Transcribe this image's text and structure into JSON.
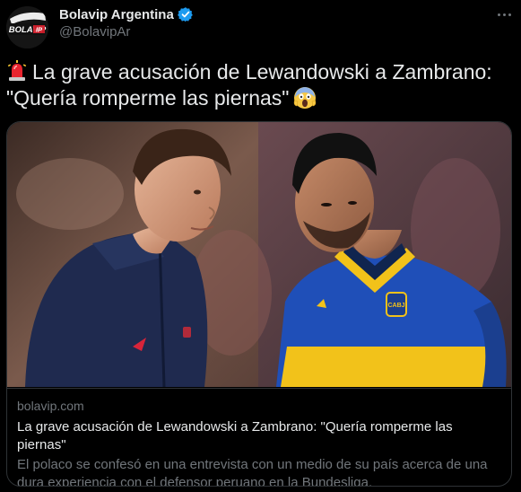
{
  "author": {
    "display_name": "Bolavip Argentina",
    "handle": "@BolavipAr",
    "avatar_text": "BOLAVIP",
    "verified_icon": "verified-badge-icon"
  },
  "tweet": {
    "text": "La grave acusación de Lewandowski a Zambrano: \"Quería romperme las piernas\"",
    "leading_emoji": "police-siren-icon",
    "trailing_emoji": "face-screaming-in-fear-icon"
  },
  "menu": {
    "icon": "more-options-icon"
  },
  "card": {
    "domain": "bolavip.com",
    "title": "La grave acusación de Lewandowski a Zambrano: \"Quería romperme las piernas\"",
    "description": "El polaco se confesó en una entrevista con un medio de su país acerca de una dura experiencia con el defensor peruano en la Bundesliga.",
    "image_badge": "CABJ"
  },
  "colors": {
    "background": "#000000",
    "text_primary": "#e7e9ea",
    "text_secondary": "#71767b",
    "border": "#2f3336",
    "verified": "#1d9bf0",
    "boca_blue": "#1b3f8f",
    "boca_yellow": "#f2c21a"
  }
}
